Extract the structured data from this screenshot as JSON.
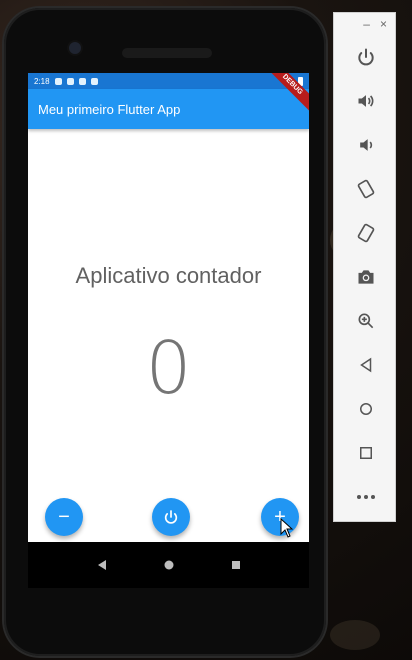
{
  "status_bar": {
    "time": "2:18",
    "debug_label": "DEBUG"
  },
  "app_bar": {
    "title": "Meu primeiro Flutter App"
  },
  "main": {
    "heading": "Aplicativo contador",
    "counter": "0"
  },
  "fabs": [
    {
      "name": "decrement",
      "label": "−"
    },
    {
      "name": "reset",
      "label": "power-icon"
    },
    {
      "name": "increment",
      "label": "+"
    }
  ],
  "emulator_window": {
    "minimize": "–",
    "close": "×"
  },
  "toolbar_icons": [
    "power-icon",
    "volume-up-icon",
    "volume-down-icon",
    "rotate-left-icon",
    "rotate-right-icon",
    "camera-icon",
    "zoom-icon",
    "back-icon",
    "home-icon",
    "overview-icon",
    "more-icon"
  ],
  "colors": {
    "primary": "#2196f3",
    "status_bar": "#1976d2",
    "text": "#616161",
    "debug_ribbon": "#b71c1c"
  }
}
